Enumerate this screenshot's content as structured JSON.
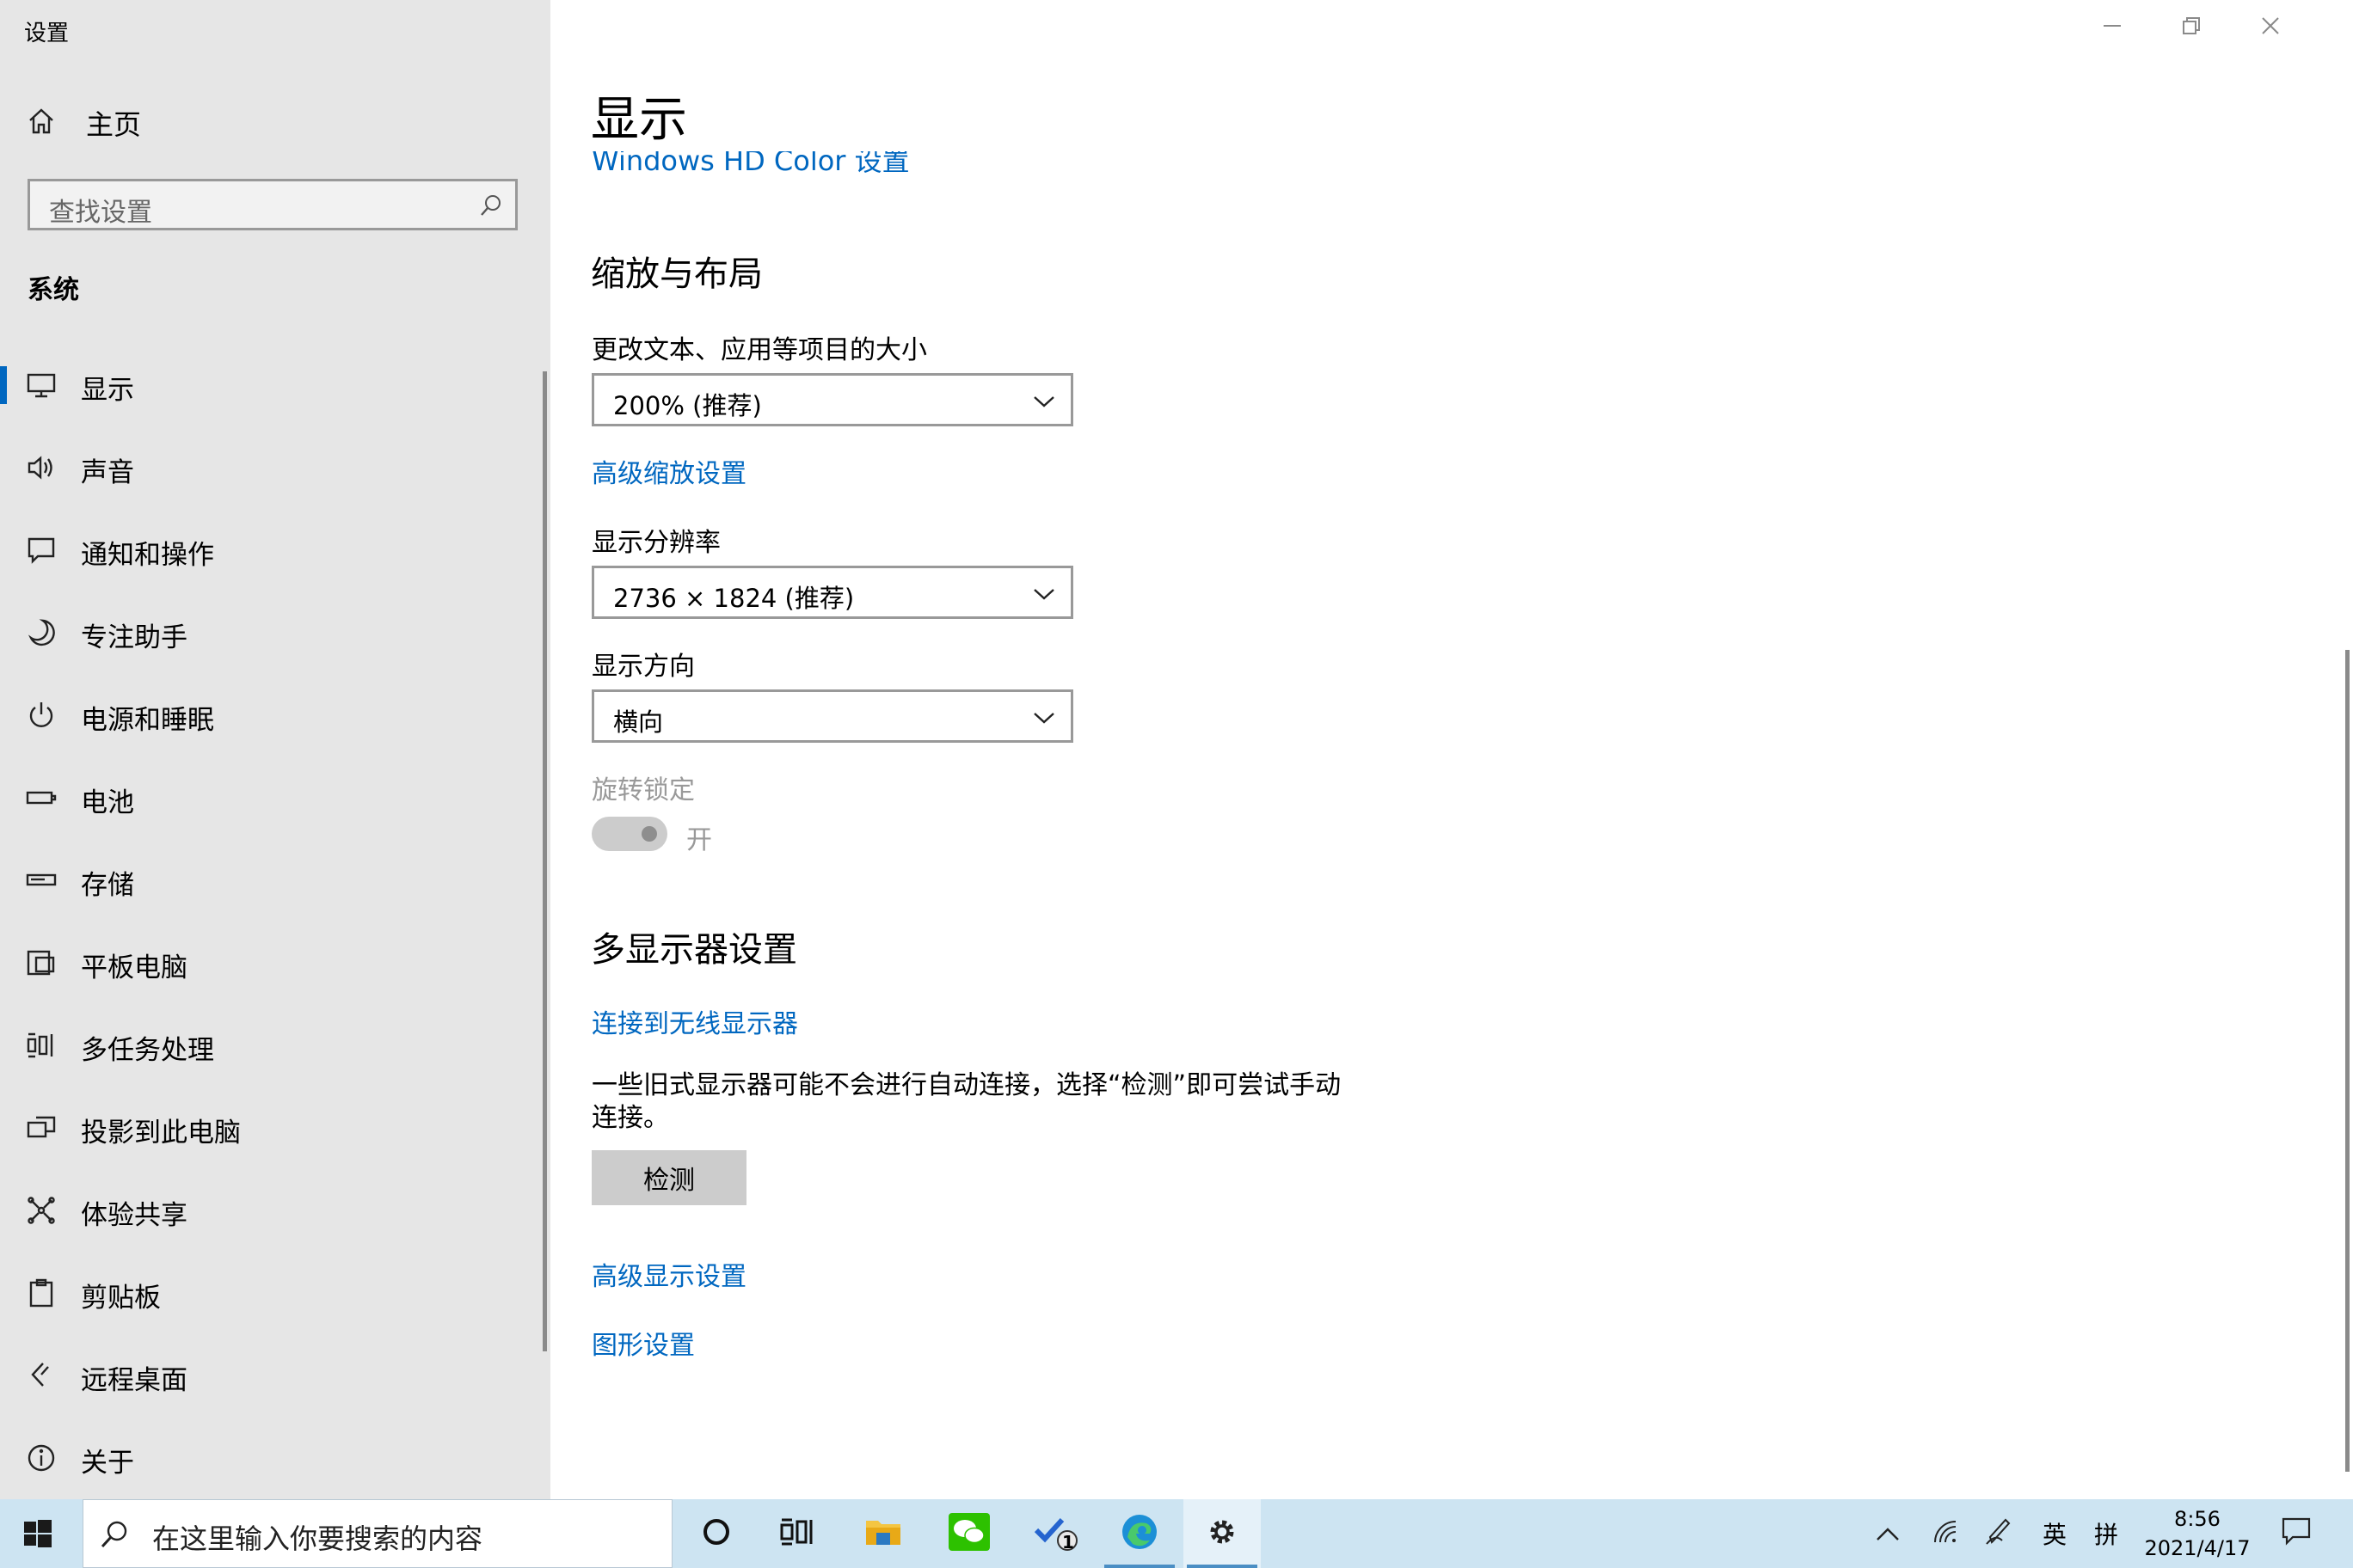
{
  "window": {
    "app_title": "设置",
    "minimize_icon": "minimize-icon",
    "restore_icon": "restore-icon",
    "close_icon": "close-icon"
  },
  "sidebar": {
    "home_label": "主页",
    "search_placeholder": "查找设置",
    "section": "系统",
    "items": [
      {
        "label": "显示",
        "icon": "monitor-icon",
        "active": true
      },
      {
        "label": "声音",
        "icon": "speaker-icon"
      },
      {
        "label": "通知和操作",
        "icon": "notification-icon"
      },
      {
        "label": "专注助手",
        "icon": "moon-icon"
      },
      {
        "label": "电源和睡眠",
        "icon": "power-icon"
      },
      {
        "label": "电池",
        "icon": "battery-icon"
      },
      {
        "label": "存储",
        "icon": "storage-icon"
      },
      {
        "label": "平板电脑",
        "icon": "tablet-icon"
      },
      {
        "label": "多任务处理",
        "icon": "multitasking-icon"
      },
      {
        "label": "投影到此电脑",
        "icon": "project-icon"
      },
      {
        "label": "体验共享",
        "icon": "share-icon"
      },
      {
        "label": "剪贴板",
        "icon": "clipboard-icon"
      },
      {
        "label": "远程桌面",
        "icon": "remote-desktop-icon"
      },
      {
        "label": "关于",
        "icon": "info-icon"
      }
    ]
  },
  "main": {
    "page_title": "显示",
    "clipped_link": "Windows HD Color 设置",
    "scale_section": {
      "heading": "缩放与布局",
      "scale_label": "更改文本、应用等项目的大小",
      "scale_value": "200% (推荐)",
      "advanced_scaling_link": "高级缩放设置",
      "resolution_label": "显示分辨率",
      "resolution_value": "2736 × 1824 (推荐)",
      "orientation_label": "显示方向",
      "orientation_value": "横向",
      "rotation_lock_label": "旋转锁定",
      "rotation_lock_state": "开"
    },
    "multi_section": {
      "heading": "多显示器设置",
      "wireless_link": "连接到无线显示器",
      "description": "一些旧式显示器可能不会进行自动连接，选择“检测”即可尝试手动连接。",
      "detect_button": "检测",
      "advanced_display_link": "高级显示设置",
      "graphics_link": "图形设置"
    }
  },
  "taskbar": {
    "search_placeholder": "在这里输入你要搜索的内容",
    "todo_badge": "1",
    "tray": {
      "ime_lang": "英",
      "ime_mode": "拼"
    },
    "time": "8:56",
    "date": "2021/4/17"
  }
}
